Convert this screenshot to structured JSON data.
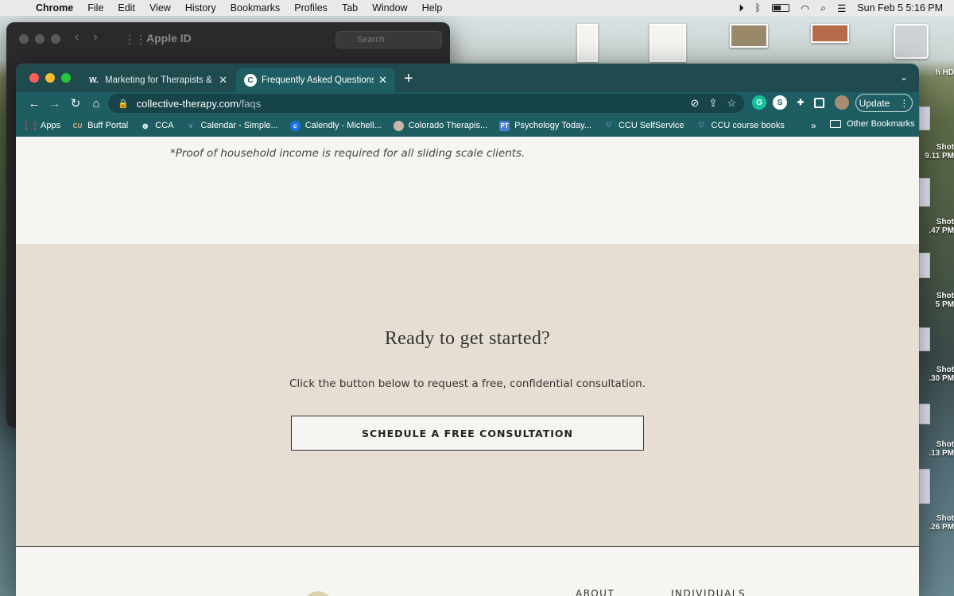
{
  "menubar": {
    "app": "Chrome",
    "items": [
      "File",
      "Edit",
      "View",
      "History",
      "Bookmarks",
      "Profiles",
      "Tab",
      "Window",
      "Help"
    ],
    "datetime": "Sun Feb 5  5:16 PM"
  },
  "background_window": {
    "title": "Apple ID",
    "search_placeholder": "Search"
  },
  "desktop": {
    "drive_label": "h HD",
    "files": [
      {
        "line1": "Shot",
        "line2": "9.11 PM"
      },
      {
        "line1": "Shot",
        "line2": ".47 PM"
      },
      {
        "line1": "Shot",
        "line2": "5 PM"
      },
      {
        "line1": "Shot",
        "line2": ".30 PM"
      },
      {
        "line1": "Shot",
        "line2": ".13 PM"
      },
      {
        "line1": "Shot",
        "line2": ".26 PM"
      }
    ]
  },
  "chrome": {
    "tabs": [
      {
        "label": "Marketing for Therapists & Cou",
        "favicon": "W."
      },
      {
        "label": "Frequently Asked Questions ab",
        "favicon": "C"
      }
    ],
    "url": {
      "domain": "collective-therapy.com",
      "path": "/faqs"
    },
    "update_label": "Update",
    "bookmarks": [
      {
        "label": "Apps",
        "color": "#e94235"
      },
      {
        "label": "Buff Portal",
        "color": "#cfb87c"
      },
      {
        "label": "CCA",
        "color": "#ffffff"
      },
      {
        "label": "Calendar - Simple...",
        "color": "#6fa3d8"
      },
      {
        "label": "Calendly - Michell...",
        "color": "#1a73e8"
      },
      {
        "label": "Colorado Therapis...",
        "color": "#c8b6a6"
      },
      {
        "label": "Psychology Today...",
        "color": "#4a7fd4"
      },
      {
        "label": "CCU SelfService",
        "color": "#1d3f6e"
      },
      {
        "label": "CCU course books",
        "color": "#1d3f6e"
      }
    ],
    "other_bookmarks": "Other Bookmarks"
  },
  "page": {
    "proof_note": "*Proof of household income is required for all sliding scale clients.",
    "cta_title": "Ready to get started?",
    "cta_subtitle": "Click the button below to request a free, confidential consultation.",
    "cta_button": "SCHEDULE A FREE CONSULTATION",
    "footer_nav": [
      "ABOUT",
      "INDIVIDUALS"
    ]
  }
}
